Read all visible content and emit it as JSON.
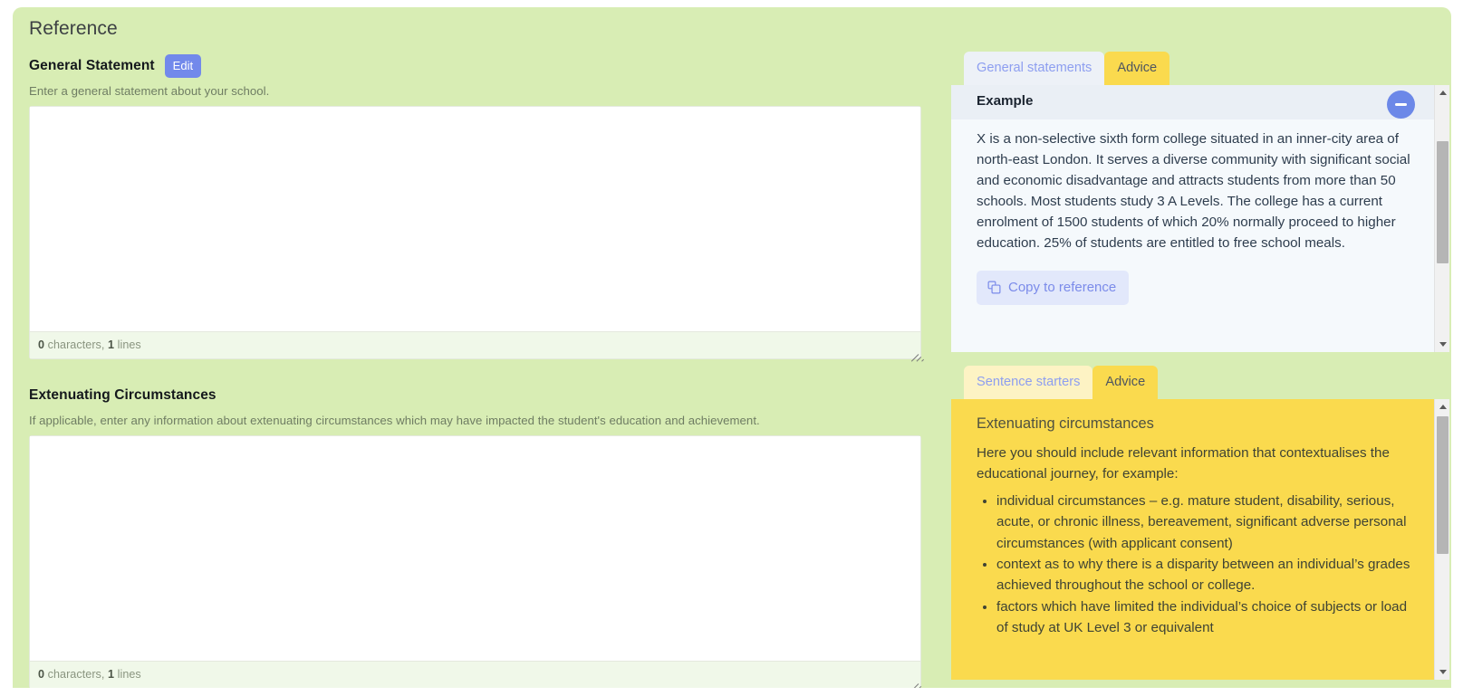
{
  "section": {
    "title": "Reference"
  },
  "general_statement": {
    "label": "General Statement",
    "edit_label": "Edit",
    "hint": "Enter a general statement about your school.",
    "textarea_value": "",
    "textarea_placeholder": "",
    "counter_chars": "0",
    "counter_chars_label": " characters, ",
    "counter_lines": "1",
    "counter_lines_label": " lines"
  },
  "extenuating_circumstances": {
    "label": "Extenuating Circumstances",
    "hint": "If applicable, enter any information about extenuating circumstances which may have impacted the student's education and achievement.",
    "textarea_value": "",
    "textarea_placeholder": "",
    "counter_chars": "0",
    "counter_chars_label": " characters, ",
    "counter_lines": "1",
    "counter_lines_label": " lines"
  },
  "example_panel": {
    "tabs": [
      {
        "label": "General statements",
        "active": false
      },
      {
        "label": "Advice",
        "active": true
      }
    ],
    "heading": "Example",
    "collapse_icon": "minus-icon",
    "body": "X is a non-selective sixth form college situated in an inner-city area of north-east London. It serves a diverse community with significant social and economic disadvantage and attracts students from more than 50 schools. Most students study 3 A Levels. The college has a current enrolment of 1500 students of which 20% normally proceed to higher education. 25% of students are entitled to free school meals.",
    "copy_button": "Copy to reference",
    "copy_icon": "copy-icon"
  },
  "advice_panel": {
    "tabs": [
      {
        "label": "Sentence starters",
        "active": false
      },
      {
        "label": "Advice",
        "active": true
      }
    ],
    "heading": "Extenuating circumstances",
    "intro": "Here you should include relevant information that contextualises the educational journey, for example:",
    "bullets": [
      "individual circumstances – e.g. mature student, disability, serious, acute, or chronic illness, bereavement, significant adverse personal circumstances (with applicant consent)",
      "context as to why there is a disparity between an individual’s grades achieved throughout the school or college.",
      "factors which have limited the individual’s choice of subjects or load of study at UK Level 3 or equivalent"
    ]
  },
  "colors": {
    "card_background": "#d8edb4",
    "accent_blue": "#7289eb",
    "accent_yellow": "#fada4e",
    "panel_light": "#f5f9fc",
    "tab_inactive_light": "#edf1f7",
    "tab_inactive_yellow": "#fdf3c4",
    "counter_background": "#f0f8e9"
  }
}
